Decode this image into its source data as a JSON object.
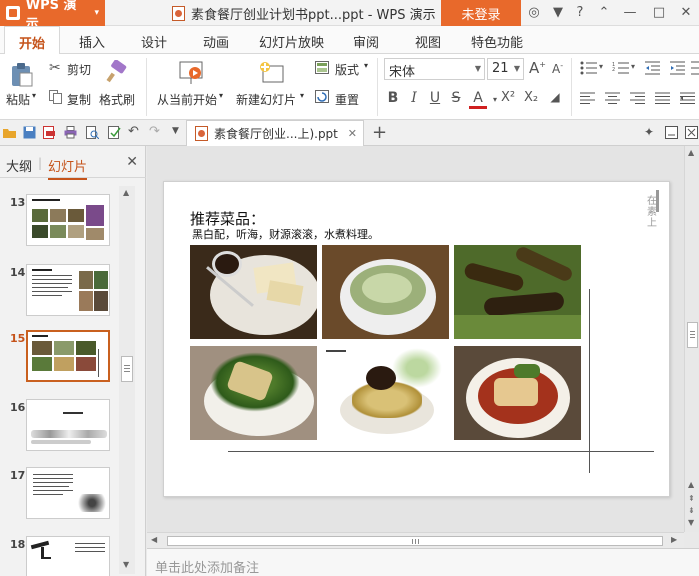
{
  "app": {
    "name": "WPS 演示",
    "doc_title": "素食餐厅创业计划书ppt...ppt - WPS 演示",
    "login_label": "未登录"
  },
  "menu": {
    "tabs": [
      "开始",
      "插入",
      "设计",
      "动画",
      "幻灯片放映",
      "审阅",
      "视图",
      "特色功能"
    ],
    "active": "开始"
  },
  "ribbon": {
    "paste": "粘贴",
    "cut": "剪切",
    "copy": "复制",
    "format_painter": "格式刷",
    "from_current": "从当前开始",
    "new_slide": "新建幻灯片",
    "layout": "版式",
    "reset": "重置",
    "font_name": "宋体",
    "font_size": "21",
    "bold": "B",
    "italic": "I",
    "underline": "U",
    "strike": "S",
    "font_color": "A",
    "superscript": "X²",
    "subscript": "X₂"
  },
  "doc_tab": {
    "label": "素食餐厅创业...上).ppt"
  },
  "panel": {
    "outline_tab": "大纲",
    "slides_tab": "幻灯片",
    "slides": [
      {
        "num": "13"
      },
      {
        "num": "14"
      },
      {
        "num": "15"
      },
      {
        "num": "16"
      },
      {
        "num": "17"
      },
      {
        "num": "18"
      }
    ],
    "active_slide": "15"
  },
  "slide": {
    "title": "推荐菜品：",
    "subtitle": "黑白配，听海，财源滚滚，水煮料理。",
    "stamp": "在素上"
  },
  "notes": {
    "placeholder": "单击此处添加备注"
  },
  "colors": {
    "accent": "#e8692b",
    "active_text": "#c5531a"
  }
}
